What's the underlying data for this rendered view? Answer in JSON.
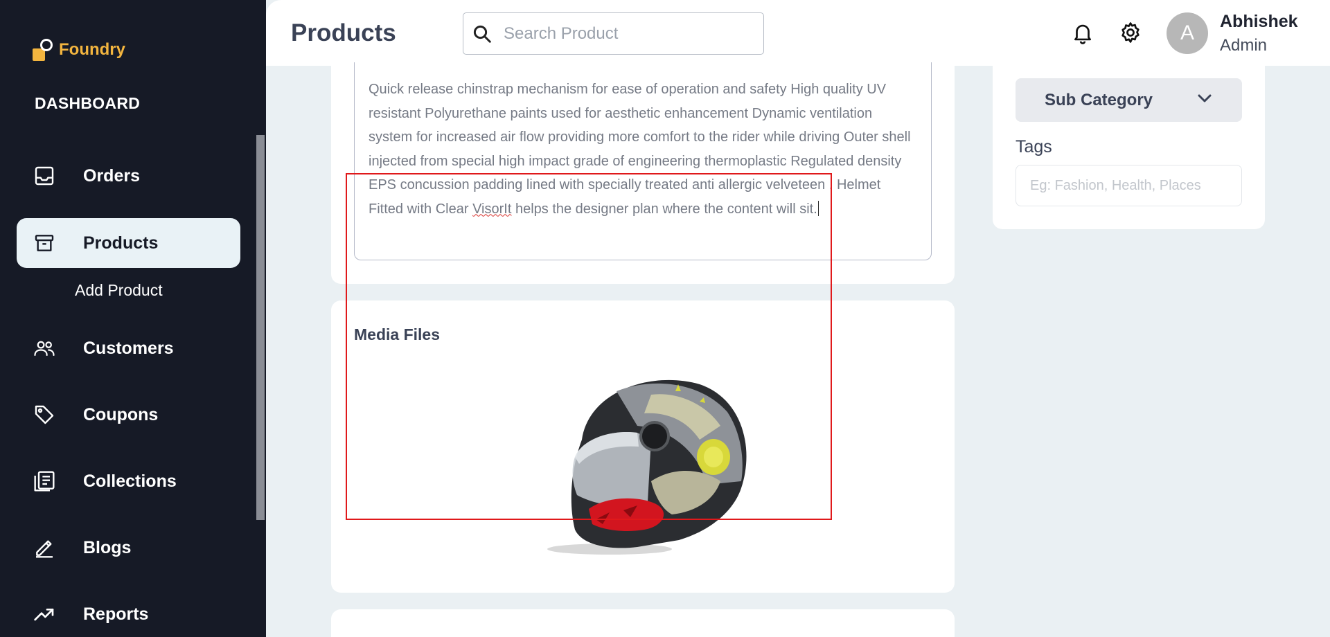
{
  "app": {
    "name": "Foundry",
    "section_heading": "DASHBOARD"
  },
  "sidebar": {
    "items": [
      {
        "label": "Orders",
        "icon": "inbox-icon"
      },
      {
        "label": "Products",
        "icon": "archive-box-icon",
        "active": true
      },
      {
        "label": "Customers",
        "icon": "users-icon"
      },
      {
        "label": "Coupons",
        "icon": "tag-icon"
      },
      {
        "label": "Collections",
        "icon": "library-icon"
      },
      {
        "label": "Blogs",
        "icon": "pen-icon"
      },
      {
        "label": "Reports",
        "icon": "trending-up-icon"
      }
    ],
    "sub_items": [
      {
        "label": "Add Product"
      }
    ]
  },
  "header": {
    "title": "Products",
    "search": {
      "placeholder": "Search Product",
      "value": ""
    },
    "icons": [
      "bell-icon",
      "gear-icon"
    ],
    "user": {
      "initial": "A",
      "name": "Abhishek",
      "role": "Admin"
    }
  },
  "product_form": {
    "description": {
      "before": "Quick release chinstrap mechanism for ease of operation and safety High quality UV resistant Polyurethane paints used for aesthetic enhancement Dynamic ventilation system for increased air flow providing more comfort to the rider while driving Outer shell injected from special high impact grade of engineering thermoplastic Regulated density EPS concussion padding lined with specially treated anti allergic velveteen . Helmet Fitted with Clear ",
      "misspelled": "VisorIt",
      "after": " helps the designer plan where the content will sit."
    },
    "media": {
      "title": "Media Files",
      "image": "helmet-image"
    },
    "sidebar_fields": {
      "sub_category": "Sub Category",
      "tags_label": "Tags",
      "tags_placeholder": "Eg: Fashion, Health, Places"
    }
  },
  "colors": {
    "sidebar_bg": "#161a26",
    "accent_logo": "#f3b53f",
    "page_bg": "#eaf0f3",
    "active_item_bg": "#e9f2f6",
    "selection_outline": "#e0191b"
  }
}
